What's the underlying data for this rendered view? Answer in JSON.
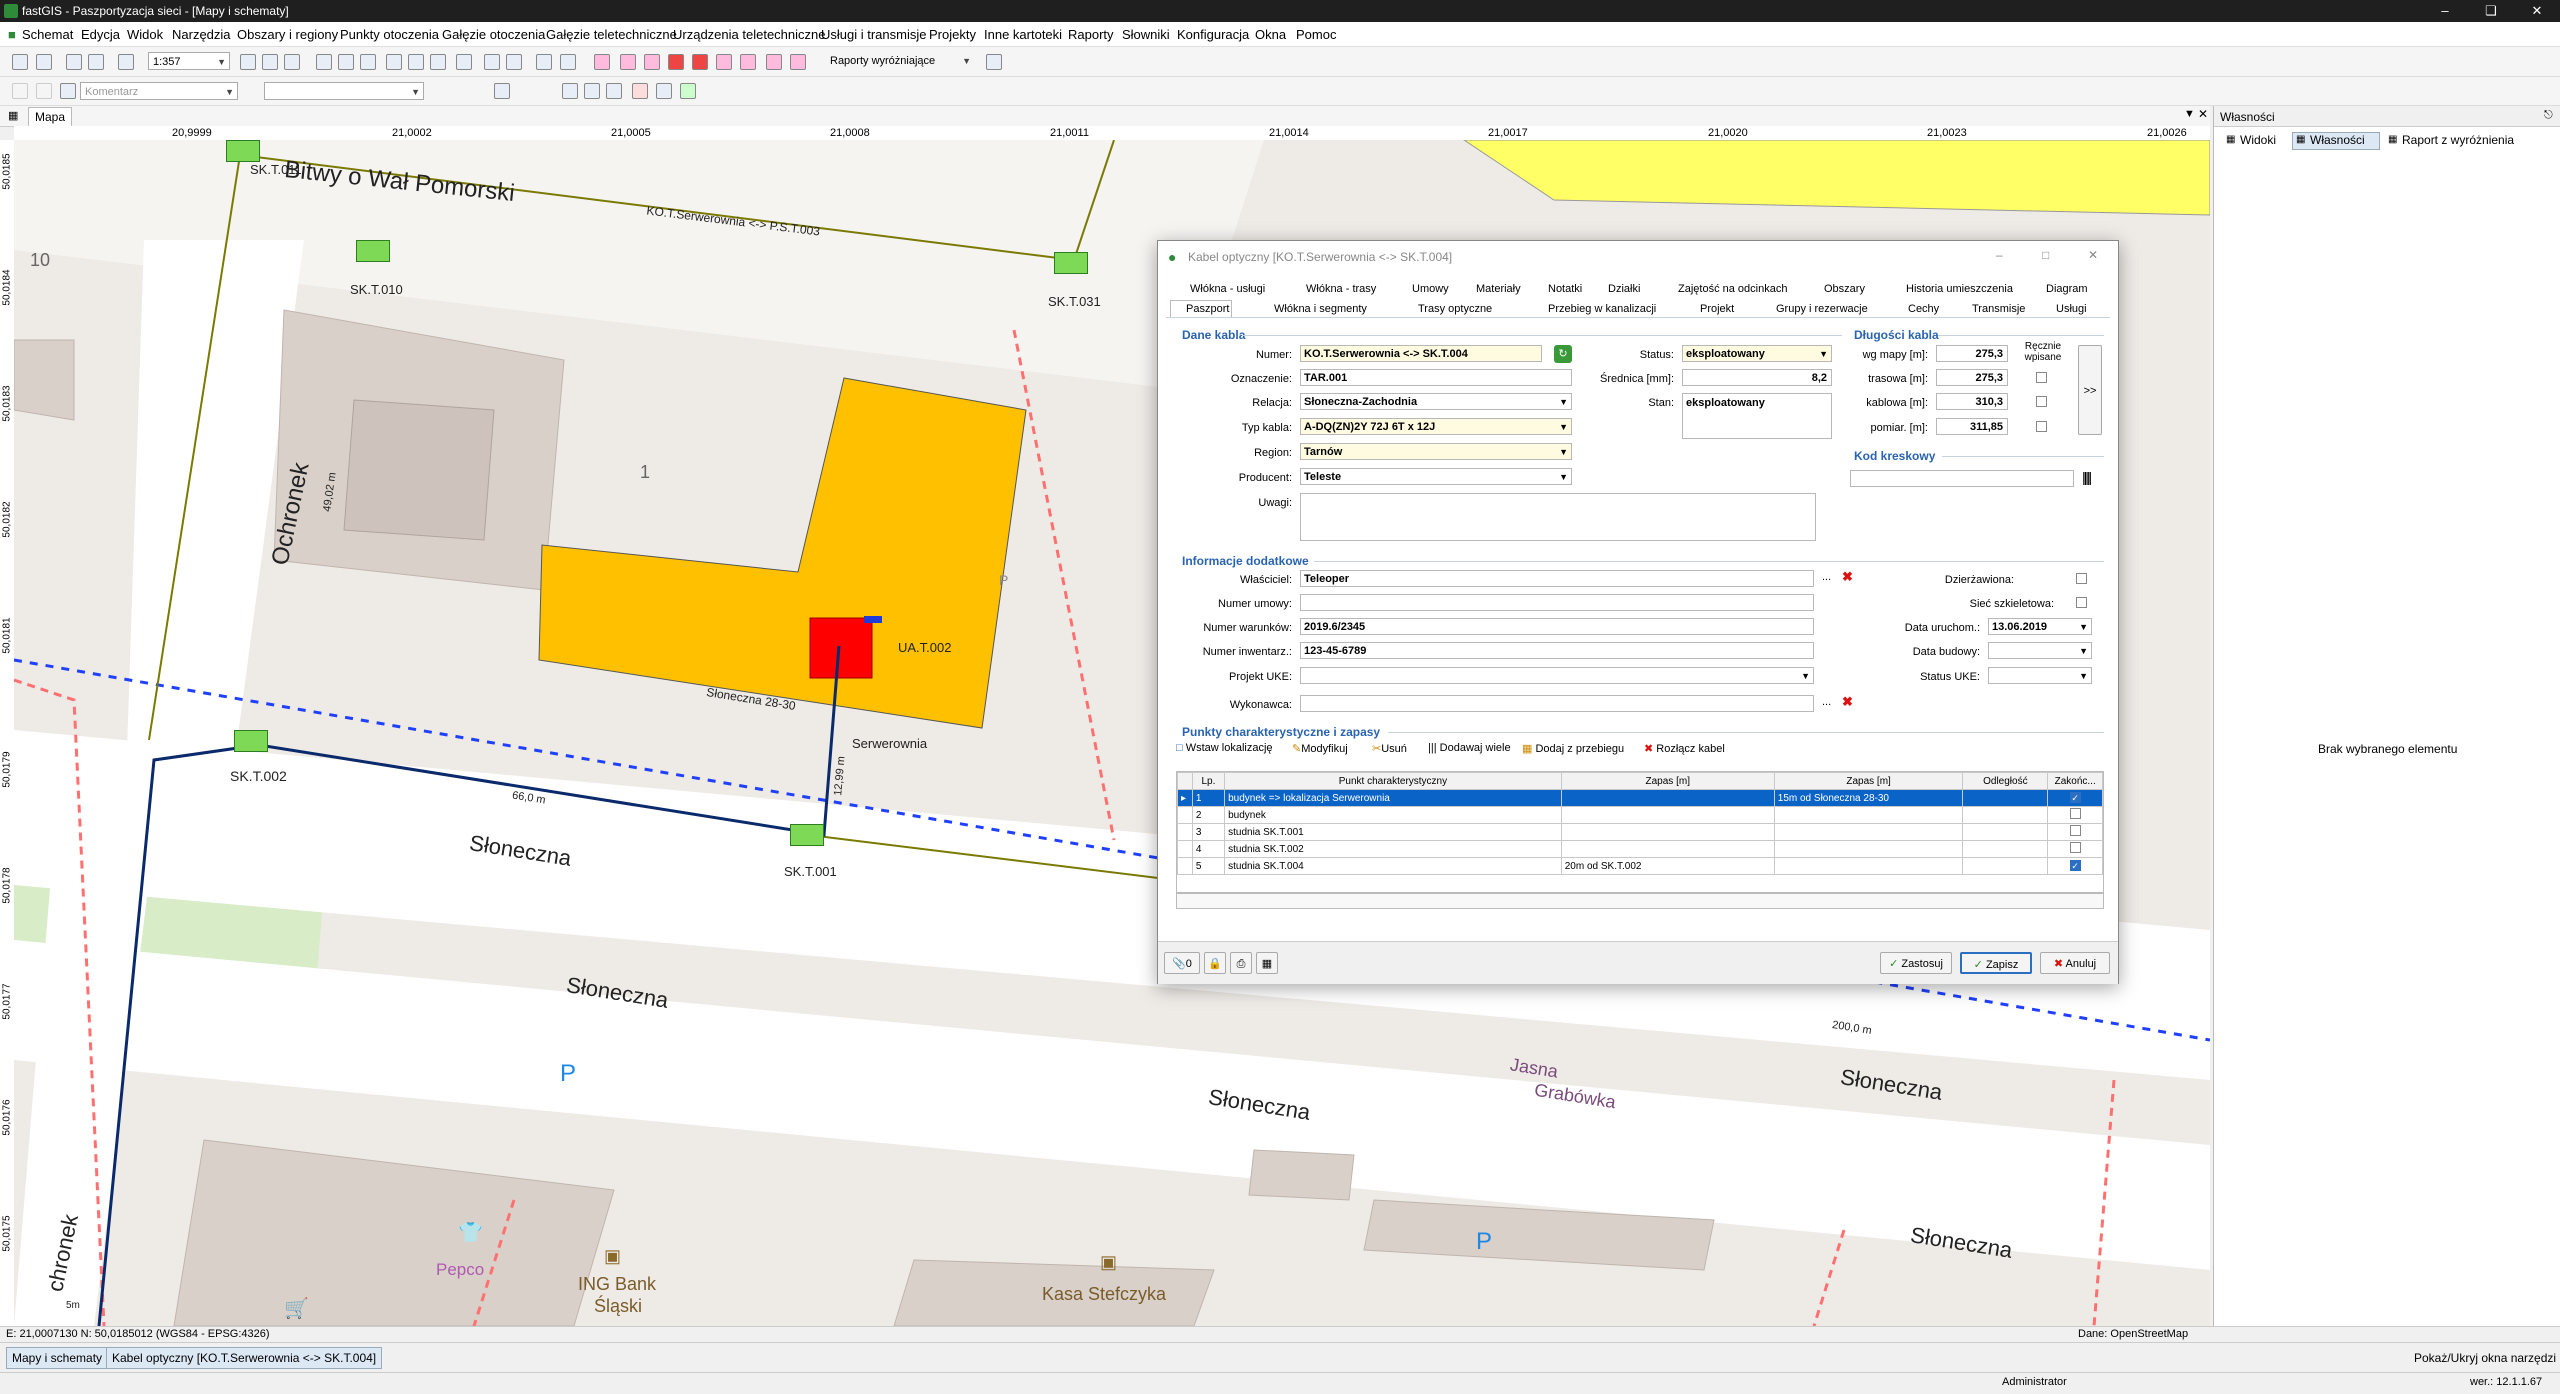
{
  "window": {
    "title": "fastGIS - Paszportyzacja sieci - [Mapy i schematy]"
  },
  "menu": [
    "Schemat",
    "Edycja",
    "Widok",
    "Narzędzia",
    "Obszary i regiony",
    "Punkty otoczenia",
    "Gałęzie otoczenia",
    "Gałęzie teletechniczne",
    "Urządzenia teletechniczne",
    "Usługi i transmisje",
    "Projekty",
    "Inne kartoteki",
    "Raporty",
    "Słowniki",
    "Konfiguracja",
    "Okna",
    "Pomoc"
  ],
  "toolbar": {
    "scale": "1:357",
    "report_label": "Raporty wyróżniające",
    "comment_placeholder": "Komentarz"
  },
  "tabs": {
    "map": "Mapa"
  },
  "ruler": {
    "x": [
      "20,9999",
      "21,0002",
      "21,0005",
      "21,0008",
      "21,0011",
      "21,0014",
      "21,0017",
      "21,0020",
      "21,0023",
      "21,0026"
    ],
    "y": [
      "50,0185",
      "50,0184",
      "50,0183",
      "50,0182",
      "50,0181",
      "50,0179",
      "50,0178",
      "50,0177",
      "50,0176",
      "50,0175"
    ]
  },
  "map": {
    "streets": [
      "Bitwy o Wał Pomorski",
      "Ochronek",
      "Słoneczna",
      "Słoneczna",
      "Słoneczna",
      "Słoneczna",
      "Słoneczna",
      "Jasna",
      "Grabówka",
      "chronek"
    ],
    "labels": {
      "sk011": "SK.T.011",
      "sk010": "SK.T.010",
      "sk031": "SK.T.031",
      "sk002": "SK.T.002",
      "sk001": "SK.T.001",
      "ua002": "UA.T.002",
      "serwerownia": "Serwerownia",
      "addr": "Słoneczna 28-30",
      "route": "KO.T.Serwerownia <-> P.S.T.003",
      "n10": "10",
      "n1": "1",
      "len1": "49,02 m",
      "len2": "12,99 m",
      "len3": "66,0 m",
      "len4": "200,0 m",
      "park1": "P",
      "park2": "P",
      "pepco": "Pepco",
      "ing1": "ING Bank",
      "ing2": "Śląski",
      "kasa": "Kasa Stefczyka",
      "scale": "5m",
      "p3": "P"
    }
  },
  "right_panel": {
    "title": "Własności",
    "tabs": [
      "Widoki",
      "Własności",
      "Raport z wyróżnienia"
    ],
    "empty": "Brak wybranego elementu"
  },
  "dialog": {
    "title": "Kabel optyczny [KO.T.Serwerownia <-> SK.T.004]",
    "tabs_row1": [
      "Włókna - usługi",
      "Włókna - trasy",
      "Umowy",
      "Materiały",
      "Notatki",
      "Działki",
      "Zajętość na odcinkach",
      "Obszary",
      "Historia umieszczenia",
      "Diagram"
    ],
    "tabs_row2": [
      "Paszport",
      "Włókna i segmenty",
      "Trasy optyczne",
      "Przebieg w kanalizacji",
      "Projekt",
      "Grupy i rezerwacje",
      "Cechy",
      "Transmisje",
      "Usługi"
    ],
    "sections": {
      "dane": "Dane kabla",
      "dlugosci": "Długości kabla",
      "kod": "Kod kreskowy",
      "info": "Informacje dodatkowe",
      "punkty": "Punkty charakterystyczne i zapasy"
    },
    "fields": {
      "numer_l": "Numer:",
      "numer": "KO.T.Serwerownia <-> SK.T.004",
      "oznaczenie_l": "Oznaczenie:",
      "oznaczenie": "TAR.001",
      "relacja_l": "Relacja:",
      "relacja": "Słoneczna-Zachodnia",
      "typ_l": "Typ kabla:",
      "typ": "A-DQ(ZN)2Y 72J 6T x 12J",
      "region_l": "Region:",
      "region": "Tarnów",
      "producent_l": "Producent:",
      "producent": "Teleste",
      "uwagi_l": "Uwagi:",
      "status_l": "Status:",
      "status": "eksploatowany",
      "srednica_l": "Średnica [mm]:",
      "srednica": "8,2",
      "stan_l": "Stan:",
      "stan": "eksploatowany",
      "wgmapy_l": "wg mapy [m]:",
      "wgmapy": "275,3",
      "trasowa_l": "trasowa [m]:",
      "trasowa": "275,3",
      "kablowa_l": "kablowa [m]:",
      "kablowa": "310,3",
      "pomiar_l": "pomiar. [m]:",
      "pomiar": "311,85",
      "recznie": "Ręcznie wpisane",
      "wlasciciel_l": "Właściciel:",
      "wlasciciel": "Teleoper",
      "umowy_l": "Numer umowy:",
      "warunkow_l": "Numer warunków:",
      "warunkow": "2019.6/2345",
      "inwentarz_l": "Numer inwentarz.:",
      "inwentarz": "123-45-6789",
      "uke_l": "Projekt UKE:",
      "wykonawca_l": "Wykonawca:",
      "dzierzawiona_l": "Dzierżawiona:",
      "szkieletowa_l": "Sieć szkieletowa:",
      "uruchom_l": "Data uruchom.:",
      "uruchom": "13.06.2019",
      "budowy_l": "Data budowy:",
      "status_uke_l": "Status UKE:"
    },
    "toolbar2": [
      "Wstaw lokalizację",
      "Modyfikuj",
      "Usuń",
      "Dodawaj wiele",
      "Dodaj z przebiegu",
      "Rozłącz kabel"
    ],
    "grid": {
      "headers": [
        "Lp.",
        "Punkt charakterystyczny",
        "Zapas [m]",
        "Zapas [m]",
        "Odległość",
        "Zakońc..."
      ],
      "rows": [
        {
          "lp": "1",
          "punkt": "budynek  => lokalizacja Serwerownia",
          "z1": "",
          "z2": "15m od Słoneczna 28-30",
          "odl": "",
          "zak": true
        },
        {
          "lp": "2",
          "punkt": "budynek",
          "z1": "",
          "z2": "",
          "odl": "",
          "zak": false
        },
        {
          "lp": "3",
          "punkt": "studnia SK.T.001",
          "z1": "",
          "z2": "",
          "odl": "",
          "zak": false
        },
        {
          "lp": "4",
          "punkt": "studnia SK.T.002",
          "z1": "",
          "z2": "",
          "odl": "",
          "zak": false
        },
        {
          "lp": "5",
          "punkt": "studnia SK.T.004",
          "z1": "20m od SK.T.002",
          "z2": "",
          "odl": "",
          "zak": true
        }
      ]
    },
    "footer": {
      "count": "0",
      "zastosuj": "Zastosuj",
      "zapisz": "Zapisz",
      "anuluj": "Anuluj"
    }
  },
  "status": {
    "coords": "E: 21,0007130  N: 50,0185012 (WGS84 - EPSG:4326)",
    "source": "Dane: OpenStreetMap"
  },
  "taskbar": {
    "tab1": "Mapy i schematy",
    "tab2": "Kabel optyczny [KO.T.Serwerownia <-> SK.T.004]",
    "toggle": "Pokaż/Ukryj okna narzędzi"
  },
  "bottom": {
    "user": "Administrator",
    "version": "wer.: 12.1.1.67"
  },
  "colors": {
    "building": "#ffc000",
    "room": "#ff0000",
    "green_box": "#7ed957",
    "section": "#2a64b0",
    "selection": "#0a64c8"
  }
}
